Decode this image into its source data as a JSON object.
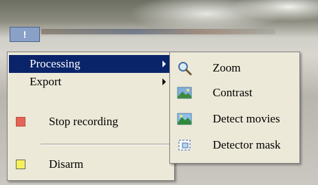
{
  "trigger": {
    "label": "!"
  },
  "main_menu": {
    "items": [
      {
        "label": "Processing",
        "submenu": true,
        "highlighted": true
      },
      {
        "label": "Export",
        "submenu": true
      },
      {
        "label": "Stop recording",
        "icon": "red-square-icon",
        "color": "#e2655a"
      },
      {
        "label": "Disarm",
        "icon": "yellow-square-icon",
        "color": "#f8f05a"
      }
    ]
  },
  "sub_menu": {
    "items": [
      {
        "label": "Zoom",
        "icon": "magnifier-icon"
      },
      {
        "label": "Contrast",
        "icon": "contrast-image-icon"
      },
      {
        "label": "Detect movies",
        "icon": "detect-movies-image-icon"
      },
      {
        "label": "Detector mask",
        "icon": "detector-mask-icon"
      }
    ]
  },
  "colors": {
    "highlight": "#0a246a",
    "menu_bg": "#ece9d8"
  }
}
